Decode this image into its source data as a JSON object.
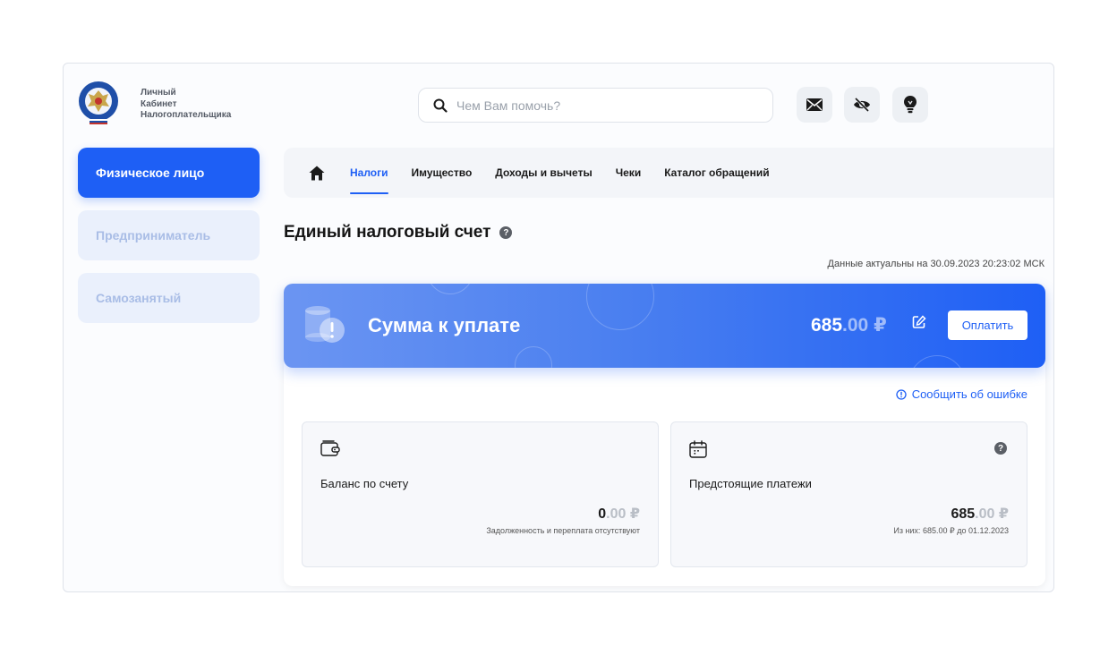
{
  "brand": {
    "line1": "Личный",
    "line2": "Кабинет",
    "line3": "Налогоплательщика"
  },
  "search": {
    "placeholder": "Чем Вам помочь?"
  },
  "header_icons": [
    "mail-icon",
    "eye-off-icon",
    "lightbulb-icon"
  ],
  "sidebar": {
    "items": [
      {
        "label": "Физическое лицо",
        "active": true
      },
      {
        "label": "Предприниматель",
        "active": false
      },
      {
        "label": "Самозанятый",
        "active": false
      }
    ]
  },
  "tabs": {
    "items": [
      {
        "label": "Налоги",
        "active": true
      },
      {
        "label": "Имущество",
        "active": false
      },
      {
        "label": "Доходы и вычеты",
        "active": false
      },
      {
        "label": "Чеки",
        "active": false
      },
      {
        "label": "Каталог обращений",
        "active": false
      }
    ]
  },
  "page": {
    "title": "Единый налоговый счет",
    "updated": "Данные актуальны на 30.09.2023 20:23:02 МСК"
  },
  "banner": {
    "title": "Сумма к уплате",
    "amount_int": "685",
    "amount_dec": ".00 ₽",
    "pay_label": "Оплатить"
  },
  "report_label": "Сообщить об ошибке",
  "balance": {
    "label": "Баланс по счету",
    "amount_int": "0",
    "amount_dec": ".00 ₽",
    "note": "Задолженность и переплата отсутствуют"
  },
  "upcoming": {
    "label": "Предстоящие платежи",
    "amount_int": "685",
    "amount_dec": ".00 ₽",
    "note": "Из них: 685.00 ₽ до 01.12.2023"
  },
  "colors": {
    "accent": "#1e5ff5",
    "inactive_side_bg": "#eaf0fc",
    "inactive_side_text": "#a9bde6"
  }
}
